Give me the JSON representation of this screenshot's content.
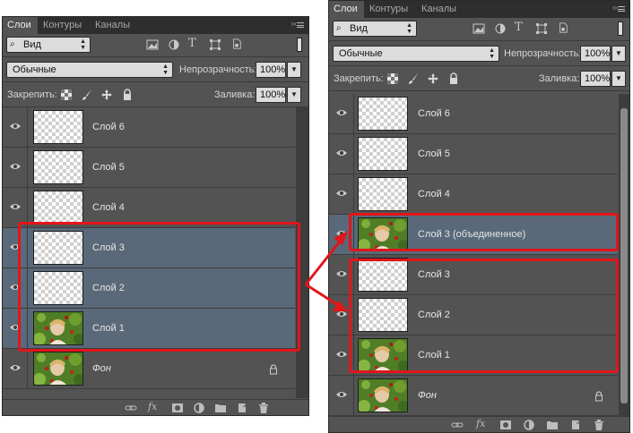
{
  "tabs": [
    "Слои",
    "Контуры",
    "Каналы"
  ],
  "filter": {
    "kind": "Вид"
  },
  "blend_mode": "Обычные",
  "opacity": {
    "label": "Непрозрачность:",
    "value": "100%"
  },
  "lock": {
    "label": "Закрепить:"
  },
  "fill": {
    "label": "Заливка:",
    "value": "100%"
  },
  "left_layers": [
    {
      "name": "Слой 6"
    },
    {
      "name": "Слой 5"
    },
    {
      "name": "Слой 4"
    },
    {
      "name": "Слой 3"
    },
    {
      "name": "Слой 2"
    },
    {
      "name": "Слой 1"
    },
    {
      "name": "Фон"
    }
  ],
  "right_layers": [
    {
      "name": "Слой 6"
    },
    {
      "name": "Слой 5"
    },
    {
      "name": "Слой 4"
    },
    {
      "name": "Слой 3 (объединенное)"
    },
    {
      "name": "Слой 3"
    },
    {
      "name": "Слой 2"
    },
    {
      "name": "Слой 1"
    },
    {
      "name": "Фон"
    }
  ],
  "footer_fx": "fx",
  "colors": {
    "highlight": "#e2151b",
    "selected_row": "#596979",
    "panel": "#535353"
  }
}
